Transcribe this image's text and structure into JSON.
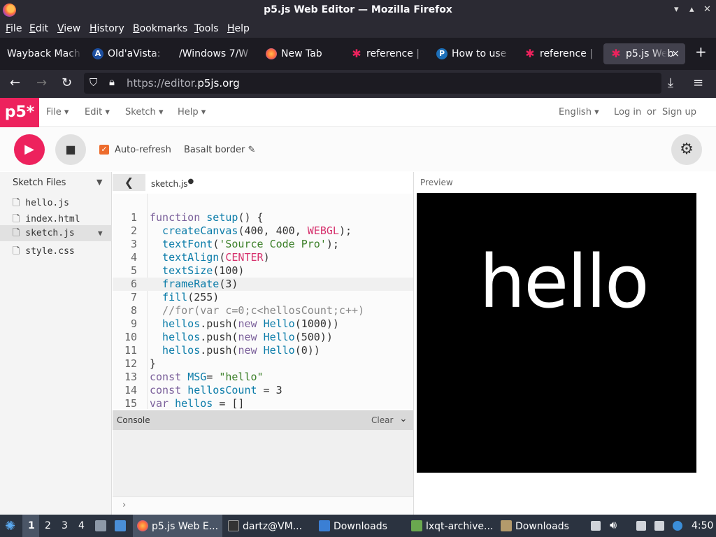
{
  "window": {
    "title": "p5.js Web Editor — Mozilla Firefox"
  },
  "menubar": [
    "File",
    "Edit",
    "View",
    "History",
    "Bookmarks",
    "Tools",
    "Help"
  ],
  "tabs": [
    {
      "label": "Wayback Mach",
      "icon": "none"
    },
    {
      "label": "Old'aVista: ",
      "icon": "AV"
    },
    {
      "label": "/Windows 7/W",
      "icon": "none"
    },
    {
      "label": "New Tab",
      "icon": "firefox"
    },
    {
      "label": "reference | ",
      "icon": "p5-star"
    },
    {
      "label": "How to use",
      "icon": "P"
    },
    {
      "label": "reference | ",
      "icon": "p5-star"
    },
    {
      "label": "p5.js Web",
      "icon": "p5-star",
      "active": true
    }
  ],
  "newtab_label": "+",
  "close_label": "×",
  "url": {
    "prefix": "https://editor.",
    "host": "p5js.org"
  },
  "p5": {
    "logo": "p5*",
    "menus": [
      "File",
      "Edit",
      "Sketch",
      "Help"
    ],
    "language": "English",
    "login": "Log in",
    "or": "or",
    "signup": "Sign up",
    "autorefresh": "Auto-refresh",
    "sketch_name": "Basalt border",
    "files_header": "Sketch Files",
    "files": [
      "hello.js",
      "index.html",
      "sketch.js",
      "style.css"
    ],
    "open_file": "sketch.js",
    "console": "Console",
    "clear": "Clear",
    "preview": "Preview",
    "canvas_text": "hello"
  },
  "code_lines": [
    [
      {
        "t": "function ",
        "c": "kw"
      },
      {
        "t": "setup",
        "c": "fn"
      },
      {
        "t": "() {",
        "c": "pl"
      }
    ],
    [
      {
        "t": "  createCanvas",
        "c": "fn"
      },
      {
        "t": "(400, 400, ",
        "c": "pl"
      },
      {
        "t": "WEBGL",
        "c": "cst"
      },
      {
        "t": ");",
        "c": "pl"
      }
    ],
    [
      {
        "t": "  textFont",
        "c": "fn"
      },
      {
        "t": "(",
        "c": "pl"
      },
      {
        "t": "'Source Code Pro'",
        "c": "str"
      },
      {
        "t": ");",
        "c": "pl"
      }
    ],
    [
      {
        "t": "  textAlign",
        "c": "fn"
      },
      {
        "t": "(",
        "c": "pl"
      },
      {
        "t": "CENTER",
        "c": "cst"
      },
      {
        "t": ")",
        "c": "pl"
      }
    ],
    [
      {
        "t": "  textSize",
        "c": "fn"
      },
      {
        "t": "(100)",
        "c": "pl"
      }
    ],
    [
      {
        "t": "  frameRate",
        "c": "fn"
      },
      {
        "t": "(3)",
        "c": "pl"
      }
    ],
    [
      {
        "t": "  fill",
        "c": "fn"
      },
      {
        "t": "(255)",
        "c": "pl"
      }
    ],
    [
      {
        "t": "  //for(var c=0;c<hellosCount;c++)",
        "c": "cm"
      }
    ],
    [
      {
        "t": "  hellos",
        "c": "vr"
      },
      {
        "t": ".push(",
        "c": "pl"
      },
      {
        "t": "new ",
        "c": "kw"
      },
      {
        "t": "Hello",
        "c": "fn"
      },
      {
        "t": "(1000))",
        "c": "pl"
      }
    ],
    [
      {
        "t": "  hellos",
        "c": "vr"
      },
      {
        "t": ".push(",
        "c": "pl"
      },
      {
        "t": "new ",
        "c": "kw"
      },
      {
        "t": "Hello",
        "c": "fn"
      },
      {
        "t": "(500))",
        "c": "pl"
      }
    ],
    [
      {
        "t": "  hellos",
        "c": "vr"
      },
      {
        "t": ".push(",
        "c": "pl"
      },
      {
        "t": "new ",
        "c": "kw"
      },
      {
        "t": "Hello",
        "c": "fn"
      },
      {
        "t": "(0))",
        "c": "pl"
      }
    ],
    [
      {
        "t": "}",
        "c": "pl"
      }
    ],
    [
      {
        "t": "const ",
        "c": "kw"
      },
      {
        "t": "MSG",
        "c": "vr"
      },
      {
        "t": "= ",
        "c": "pl"
      },
      {
        "t": "\"hello\"",
        "c": "str"
      }
    ],
    [
      {
        "t": "const ",
        "c": "kw"
      },
      {
        "t": "hellosCount",
        "c": "vr"
      },
      {
        "t": " = 3",
        "c": "pl"
      }
    ],
    [
      {
        "t": "var ",
        "c": "kw"
      },
      {
        "t": "hellos",
        "c": "vr"
      },
      {
        "t": " = []",
        "c": "pl"
      }
    ]
  ],
  "taskbar": {
    "workspaces": [
      "1",
      "2",
      "3",
      "4"
    ],
    "items": [
      "p5.js Web E...",
      "dartz@VM...",
      "Downloads",
      "lxqt-archive...",
      "Downloads"
    ],
    "clock": "4:50"
  },
  "colors": {
    "accent": "#ed225d",
    "checkbox": "#ed6c2d"
  }
}
